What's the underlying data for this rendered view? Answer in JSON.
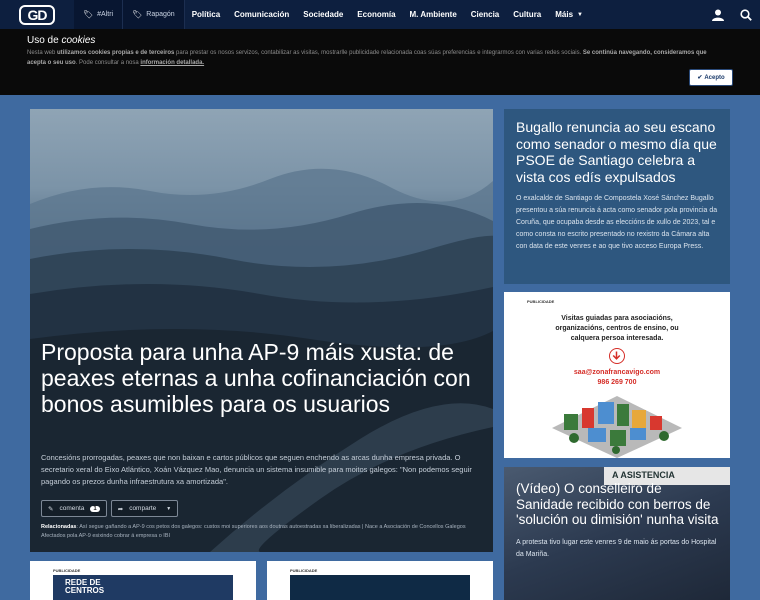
{
  "nav": {
    "logo": "GD",
    "tags": [
      "#Altri",
      "Rapagón"
    ],
    "items": [
      "Política",
      "Comunicación",
      "Sociedade",
      "Economía",
      "M. Ambiente",
      "Ciencia",
      "Cultura",
      "Máis"
    ]
  },
  "cookie": {
    "title_prefix": "Uso de ",
    "title_em": "cookies",
    "text_1": "Nesta web ",
    "text_b1": "utilizamos cookies propias e de terceiros",
    "text_2": " para prestar os nosos servizos, contabilizar as visitas, mostrarlle publicidade relacionada coas súas preferencias e integrarmos con varias redes sociais. ",
    "text_b2": "Se continúa navegando, consideramos que acepta o seu uso",
    "text_3": ". Pode consultar a nosa ",
    "text_link": "información detallada.",
    "accept": "Acepto"
  },
  "hero": {
    "title": "Proposta para unha AP-9 máis xusta: de peaxes eternas a unha cofinanciación con bonos asumibles para os usuarios",
    "lead": "Concesións prorrogadas, peaxes que non baixan e cartos públicos que seguen enchendo as arcas dunha empresa privada. O secretario xeral do Eixo Atlántico, Xoán Vázquez Mao, denuncia un sistema insumible para moitos galegos: \"Non podemos seguir pagando os prezos dunha infraestrutura xa amortizada\".",
    "comment_label": "comenta",
    "comment_count": "1",
    "share_label": "comparte",
    "related_label": "Relacionadas",
    "related_text": ": Así segue gañando a AP-9 cos petos dos galegos: custos moi superiores aos doutras autoestradas xa liberalizadas | Nace a Asociación de Concellos Galegos Afectados pola AP-9 esixindo cobrar á empresa o IBI"
  },
  "side1": {
    "title": "Bugallo renuncia ao seu escano como senador o mesmo día que PSOE de Santiago celebra a vista cos edís expulsados",
    "text": "O exalcalde de Santiago de Compostela Xosé Sánchez Bugallo presentou a súa renuncia á acta como senador pola provincia da Coruña, que ocupaba desde as eleccións de xullo de 2023, tal e como consta no escrito presentado no rexistro da Cámara alta con data de este venres e ao que tivo acceso Europa Press."
  },
  "ad1": {
    "label": "PUBLICIDADE",
    "text": "Visitas guiadas para asociacións, organizacións, centros de ensino, ou calquera persoa interesada.",
    "email": "saa@zonafrancavigo.com",
    "phone": "986 269 700"
  },
  "side2": {
    "banner": "A ASISTENCIA",
    "title": "(Vídeo) O conselleiro de Sanidade recibido con berros de 'solución ou dimisión' nunha visita",
    "text": "A protesta tivo lugar este venres 9 de maio ás portas do Hospital da Mariña."
  },
  "ad_bottom": {
    "label": "PUBLICIDADE",
    "ad1_text": "REDE DE",
    "ad1_text2": "CENTROS",
    "ad2_text": ""
  }
}
